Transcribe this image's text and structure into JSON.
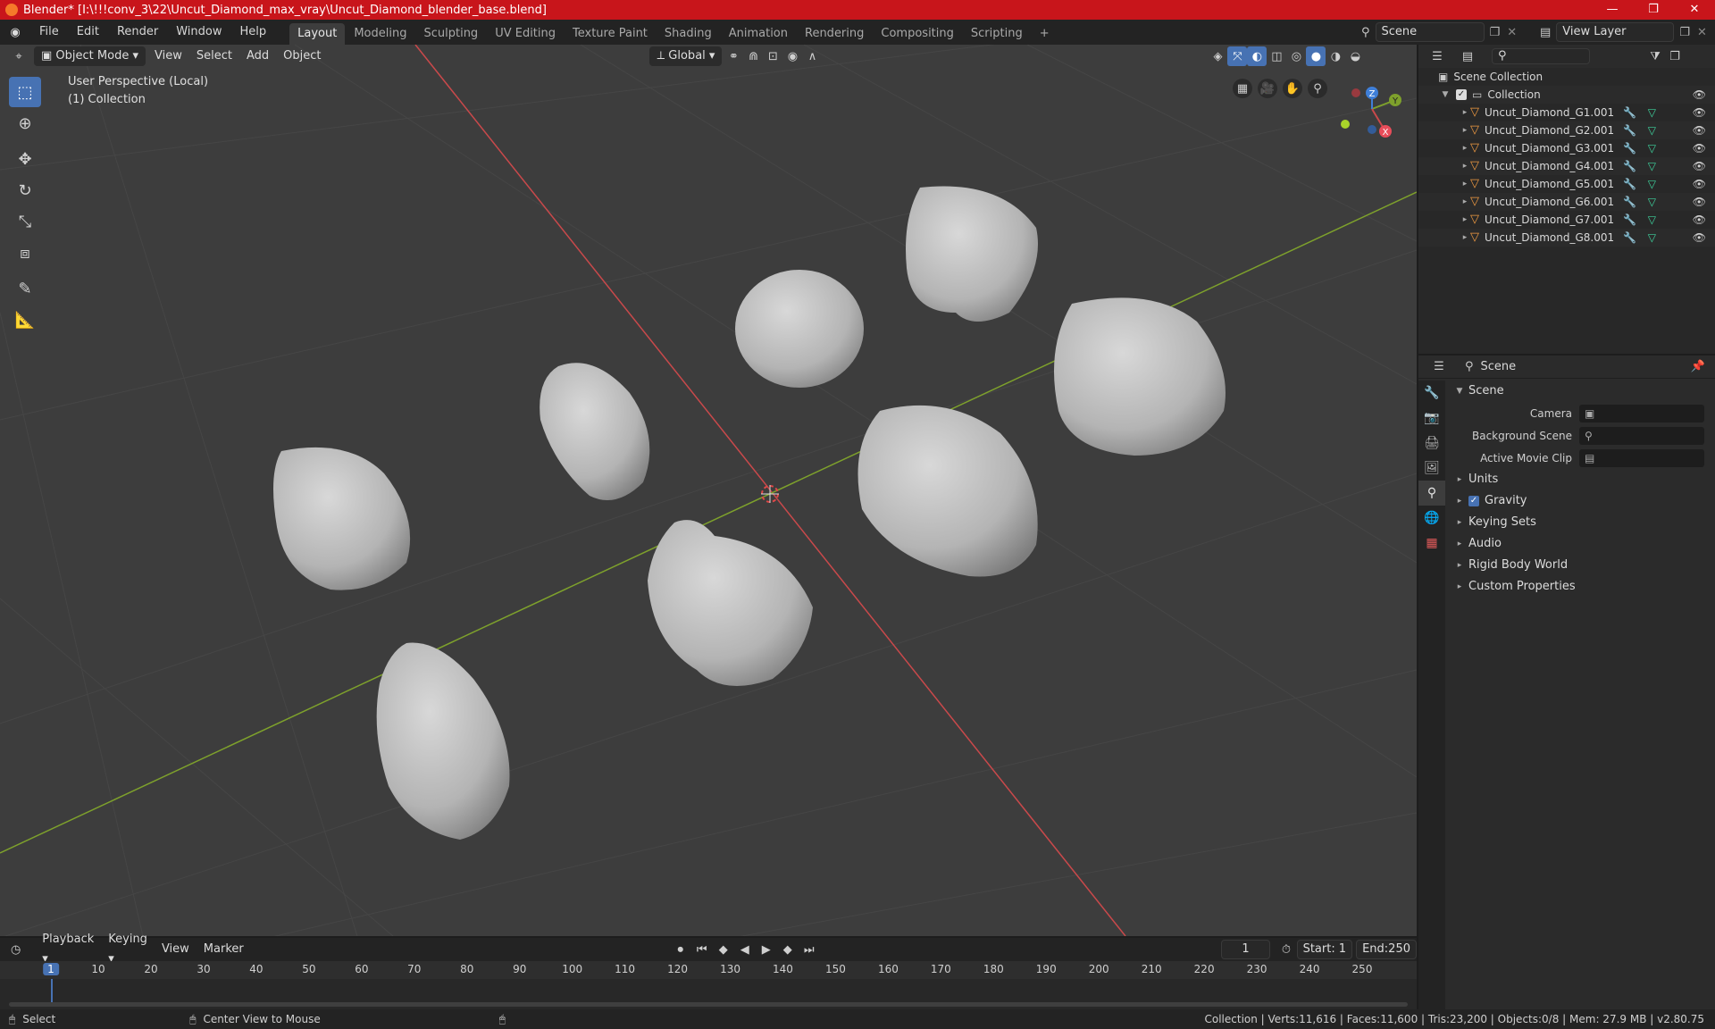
{
  "window": {
    "title": "Blender* [I:\\!!!conv_3\\22\\Uncut_Diamond_max_vray\\Uncut_Diamond_blender_base.blend]",
    "controls": [
      "—",
      "❐",
      "✕"
    ]
  },
  "menu": [
    "File",
    "Edit",
    "Render",
    "Window",
    "Help"
  ],
  "workspaces": [
    "Layout",
    "Modeling",
    "Sculpting",
    "UV Editing",
    "Texture Paint",
    "Shading",
    "Animation",
    "Rendering",
    "Compositing",
    "Scripting"
  ],
  "active_workspace": "Layout",
  "add_workspace": "+",
  "scene_field": "Scene",
  "view_layer_field": "View Layer",
  "viewport_header": {
    "mode": "Object Mode",
    "menus": [
      "View",
      "Select",
      "Add",
      "Object"
    ],
    "transform_orientation": "Global"
  },
  "viewport": {
    "perspective": "User Perspective (Local)",
    "collection": "(1) Collection",
    "axis_labels": {
      "x": "X",
      "y": "Y",
      "z": "Z"
    }
  },
  "outliner": {
    "root": "Scene Collection",
    "collection": "Collection",
    "objects": [
      "Uncut_Diamond_G1.001",
      "Uncut_Diamond_G2.001",
      "Uncut_Diamond_G3.001",
      "Uncut_Diamond_G4.001",
      "Uncut_Diamond_G5.001",
      "Uncut_Diamond_G6.001",
      "Uncut_Diamond_G7.001",
      "Uncut_Diamond_G8.001"
    ]
  },
  "properties": {
    "context": "Scene",
    "panel_title": "Scene",
    "fields": [
      {
        "label": "Camera",
        "value": ""
      },
      {
        "label": "Background Scene",
        "value": ""
      },
      {
        "label": "Active Movie Clip",
        "value": ""
      }
    ],
    "sections": [
      "Units",
      "Gravity",
      "Keying Sets",
      "Audio",
      "Rigid Body World",
      "Custom Properties"
    ]
  },
  "timeline": {
    "menus": [
      "Playback",
      "Keying",
      "View",
      "Marker"
    ],
    "current_frame": "1",
    "start_label": "Start:",
    "start_value": "1",
    "end_label": "End:",
    "end_value": "250",
    "ruler_ticks": [
      "1",
      "10",
      "20",
      "30",
      "40",
      "50",
      "60",
      "70",
      "80",
      "90",
      "100",
      "110",
      "120",
      "130",
      "140",
      "150",
      "160",
      "170",
      "180",
      "190",
      "200",
      "210",
      "220",
      "230",
      "240",
      "250"
    ]
  },
  "statusbar": {
    "left_action": "Select",
    "middle_action": "Center View to Mouse",
    "stats": "Collection | Verts:11,616 | Faces:11,600 | Tris:23,200 | Objects:0/8 | Mem: 27.9 MB | v2.80.75"
  },
  "colors": {
    "title_bar": "#c8151b",
    "viewport_bg": "#3d3d3d",
    "accent": "#4772b3",
    "x_axis": "#c9494b",
    "y_axis": "#7ea12c"
  }
}
